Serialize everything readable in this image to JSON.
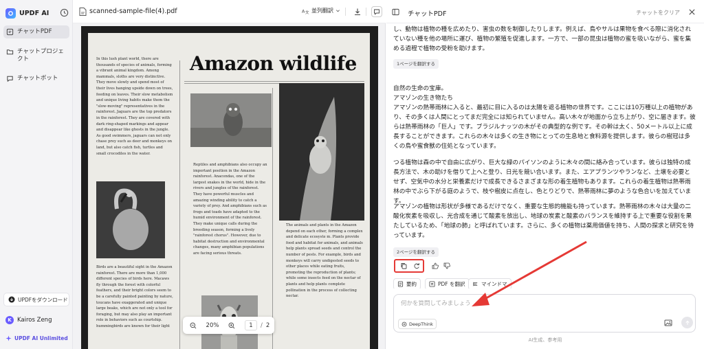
{
  "sidebar": {
    "brand": "UPDF AI",
    "items": [
      {
        "label": "チャットPDF"
      },
      {
        "label": "チャットプロジェクト"
      },
      {
        "label": "チャットボット"
      }
    ],
    "download_label": "UPDFをダウンロード",
    "user_initial": "K",
    "user_name": "Kairos Zeng",
    "unlimited_label": "UPDF AI Unlimited"
  },
  "viewer": {
    "file_name": "scanned-sample-file(4).pdf",
    "translate_label": "並列翻訳",
    "zoom": "20%",
    "page_current": "1",
    "page_total": "2",
    "document": {
      "title": "Amazon wildlife",
      "col1_top": "In this lush plant world, there are thousands of species of animals, forming a vibrant animal kingdom. Among mammals, sloths are very distinctive. They move slowly and spend most of their lives hanging upside down on trees, feeding on leaves. Their slow metabolism and unique living habits make them the \"slow-moving\" representatives in the rainforest. Jaguars are the top predators in the rainforest. They are covered with dark ring-shaped markings and appear and disappear like ghosts in the jungle. As good swimmers, jaguars can not only chase prey such as deer and monkeys on land, but also catch fish, turtles and small crocodiles in the water.",
      "col1_bottom": "Birds are a beautiful sight in the Amazon rainforest. There are more than 1,000 different species of birds here. Macaws fly through the forest with colorful feathers, and their bright colors seem to be a carefully painted painting by nature, toucans have exaggerated and unique large beaks, which are not only a tool for foraging, but may also play an important role in behaviors such as courtship. hummingbirds are known for their light",
      "col2": "Reptiles and amphibians also occupy an important position in the Amazon rainforest. Anacondas, one of the largest snakes in the world, hide in the rivers and jungles of the rainforest. They have powerful muscles and amazing winding ability to catch a variety of prey. And amphibians such as frogs and toads have adapted to the humid environment of the rainforest. They make unique calls during the breeding season, forming a lively \"rainforest chorus\". However, due to habitat destruction and environmental changes, many amphibian populations are facing serious threats.",
      "col3": "The animals and plants in the Amazon depend on each other, forming a complex and delicate ecosyste m. Plants provide food and habitat for animals, and animals help plants spread seeds and control the number of pests. For example, birds and monkeys will carry undigested seeds to other places while eating fruits, promoting the reproduction of plants; while some insects feed on the nectar of plants and help plants complete pollination in the process of collecting nectar."
    }
  },
  "chat": {
    "title": "チャットPDF",
    "clear_label": "チャットをクリア",
    "para_top": "し、動物は植物の種を広めたり、害虫の数を制御したりします。例えば、鳥やサルは果物を食べる際に消化されていない種を他の場所に運び、植物の繁殖を促進します。一方で、一部の昆虫は植物の蜜を吸いながら、蜜を集める過程で植物の受粉を助けます。",
    "tag1": "1ページを翻訳する",
    "para_a": "自然の生命の宝庫。",
    "para_b": "アマゾンの生き物たち",
    "para_c": "アマゾンの熱帯雨林に入ると、最初に目に入るのは太陽を遮る植物の世界です。ここには10万種以上の植物があり、その多くは人間にとってまだ完全には知られていません。高い木々が地面から立ち上がり、空に届きます。彼らは熱帯雨林の「巨人」です。ブラジルナッツの木がその典型的な例です。その幹は太く、50メートル以上に成長することができます。これらの木々は多くの生き物にとっての生息地と食料源を提供します。彼らの樹冠は多くの鳥や蜜食獣の住処となっています。",
    "para_d": "つる植物は森の中で自由に広がり、巨大な緑のパイソンのように木々の間に絡み合っています。彼らは独特の成長方法で、木の助けを借りて上へと登り、日光を競い合います。また、エアプランツやランなど、土壌を必要とせず、空気中の水分と栄養素だけで成長できるさまざまな形の着生植物もあります。これらの着生植物は熱帯雨林の中でぶら下がる庭のようで、枝や樹皮に点在し、色とりどりで、熱帯雨林に夢のような色合いを加えています。",
    "para_e": "アマゾンの植物は形状が多様であるだけでなく、重要な生態的機能も持っています。熱帯雨林の木々は大量の二酸化炭素を吸収し、光合成を通じて酸素を放出し、地球の炭素と酸素のバランスを維持する上で重要な役割を果たしているため、「地球の肺」と呼ばれています。さらに、多くの植物は薬用価値を持ち、人間の探求と研究を待っています。",
    "tag2": "2ページを翻訳する",
    "chips": [
      "要約",
      "PDF を翻訳",
      "マインドマ"
    ],
    "input_placeholder": "何かを質問してみましょう",
    "deepthink_label": "DeepThink",
    "footer_note": "AI生成、参考用"
  },
  "colors": {
    "accent": "#6a5cff",
    "highlight_box": "#e53935",
    "arrow": "#e53935"
  }
}
